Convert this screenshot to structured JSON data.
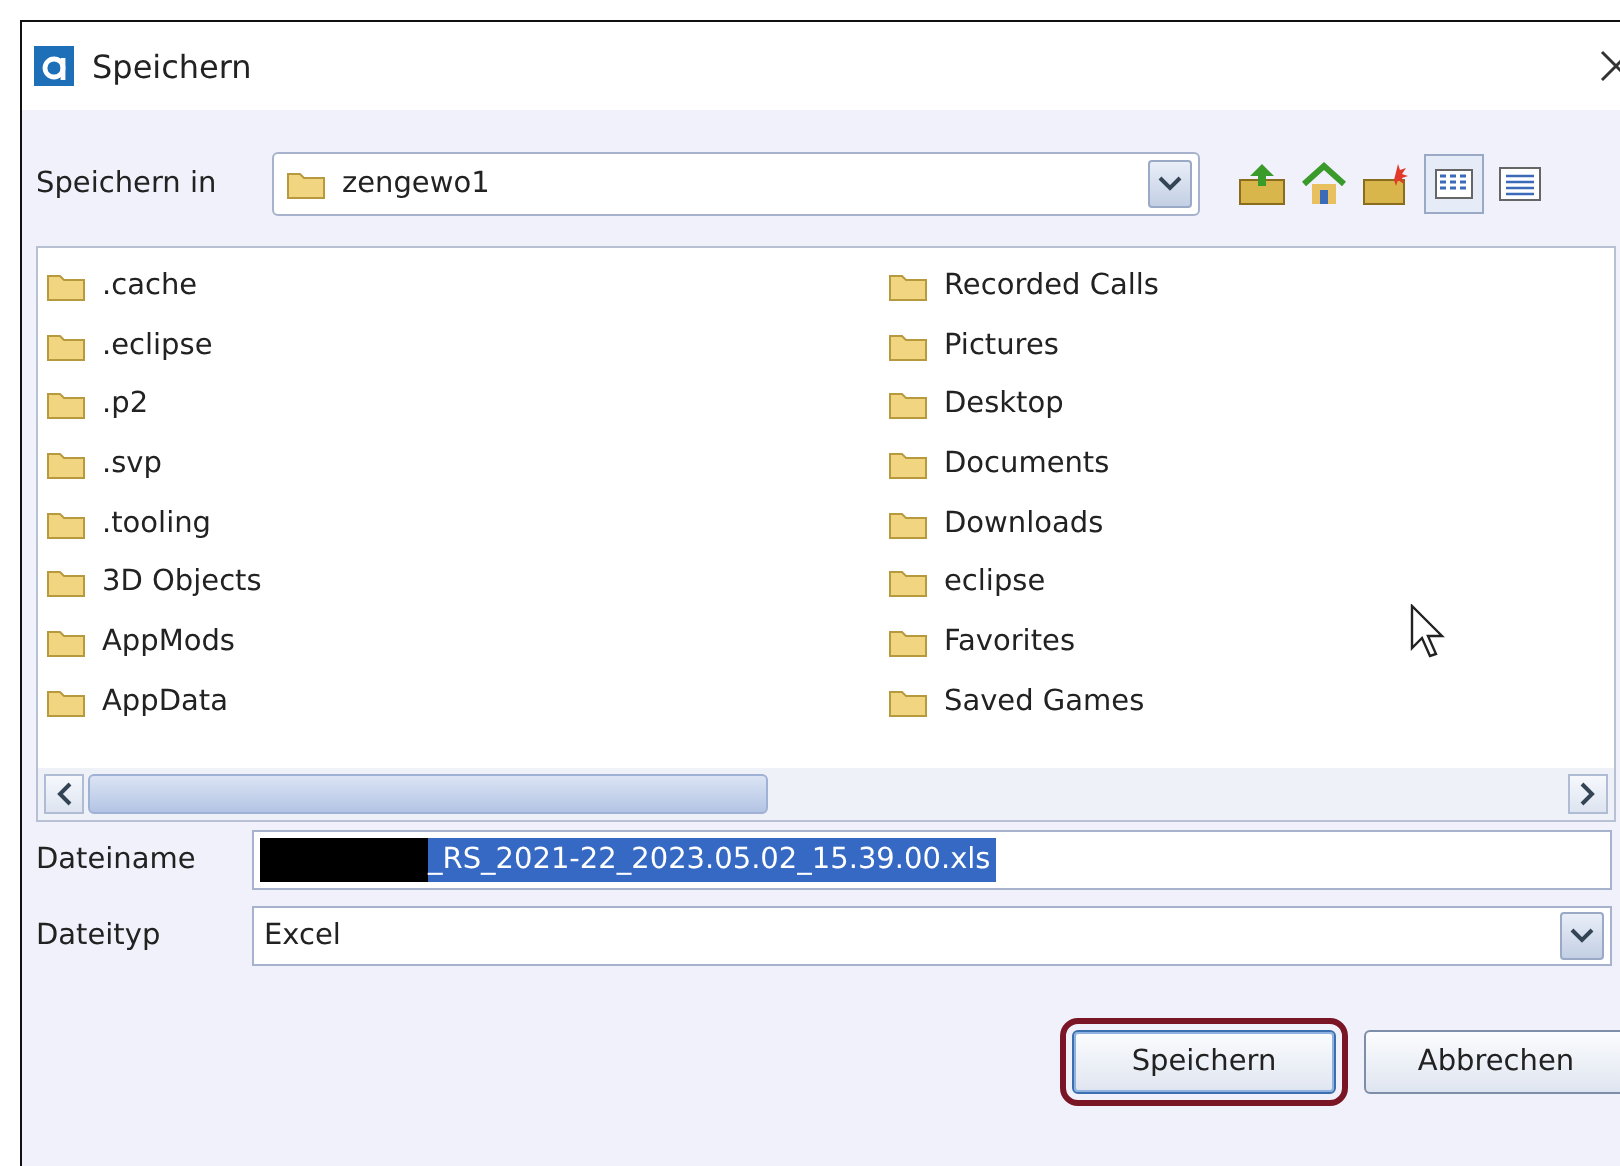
{
  "window": {
    "title": "Speichern"
  },
  "location": {
    "label": "Speichern in",
    "value": "zengewo1"
  },
  "files": [
    {
      "name": ".cache"
    },
    {
      "name": ".eclipse"
    },
    {
      "name": ".p2"
    },
    {
      "name": ".svp"
    },
    {
      "name": ".tooling"
    },
    {
      "name": "3D Objects"
    },
    {
      "name": "AppMods"
    },
    {
      "name": "AppData"
    },
    {
      "name": "Recorded Calls"
    },
    {
      "name": "Pictures"
    },
    {
      "name": "Desktop"
    },
    {
      "name": "Documents"
    },
    {
      "name": "Downloads"
    },
    {
      "name": "eclipse"
    },
    {
      "name": "Favorites"
    },
    {
      "name": "Saved Games"
    }
  ],
  "filename": {
    "label": "Dateiname",
    "value": "_RS_2021-22_2023.05.02_15.39.00.xls"
  },
  "filetype": {
    "label": "Dateityp",
    "value": "Excel"
  },
  "buttons": [
    {
      "label": "Speichern",
      "highlighted": true
    },
    {
      "label": "Abbrechen",
      "highlighted": false
    }
  ]
}
